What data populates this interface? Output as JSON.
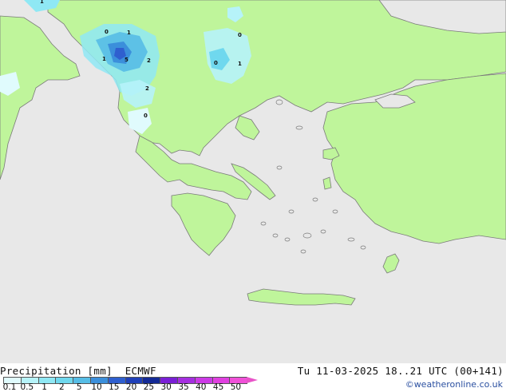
{
  "map": {
    "sea_color": "#e8e8e8",
    "land_color": "#bff59b",
    "coast_color": "#7a7a7a",
    "precip_labels": [
      {
        "text": "1"
      },
      {
        "text": "0"
      },
      {
        "text": "1"
      },
      {
        "text": "1"
      },
      {
        "text": "5"
      },
      {
        "text": "2"
      },
      {
        "text": "2"
      },
      {
        "text": "0"
      },
      {
        "text": "0"
      },
      {
        "text": "0"
      },
      {
        "text": "1"
      }
    ]
  },
  "legend": {
    "title": "Precipitation [mm]",
    "model": "ECMWF",
    "scale": [
      {
        "label": "0.1",
        "color": "#e0fbfd"
      },
      {
        "label": "0.5",
        "color": "#b6f3f9"
      },
      {
        "label": "1",
        "color": "#8fe8f4"
      },
      {
        "label": "2",
        "color": "#6fd8ee"
      },
      {
        "label": "5",
        "color": "#56bde6"
      },
      {
        "label": "10",
        "color": "#3b8fdb"
      },
      {
        "label": "15",
        "color": "#2f5fcf"
      },
      {
        "label": "20",
        "color": "#1f3fb8"
      },
      {
        "label": "25",
        "color": "#142a96"
      },
      {
        "label": "30",
        "color": "#7a1fd6"
      },
      {
        "label": "35",
        "color": "#a52fe0"
      },
      {
        "label": "40",
        "color": "#cc3ae6"
      },
      {
        "label": "45",
        "color": "#e040e0"
      },
      {
        "label": "50",
        "color": "#f050d8"
      }
    ],
    "arrow_color": "#e854c8"
  },
  "footer": {
    "datetime": "Tu 11-03-2025 18..21 UTC (00+141)",
    "credit": "©weatheronline.co.uk"
  }
}
